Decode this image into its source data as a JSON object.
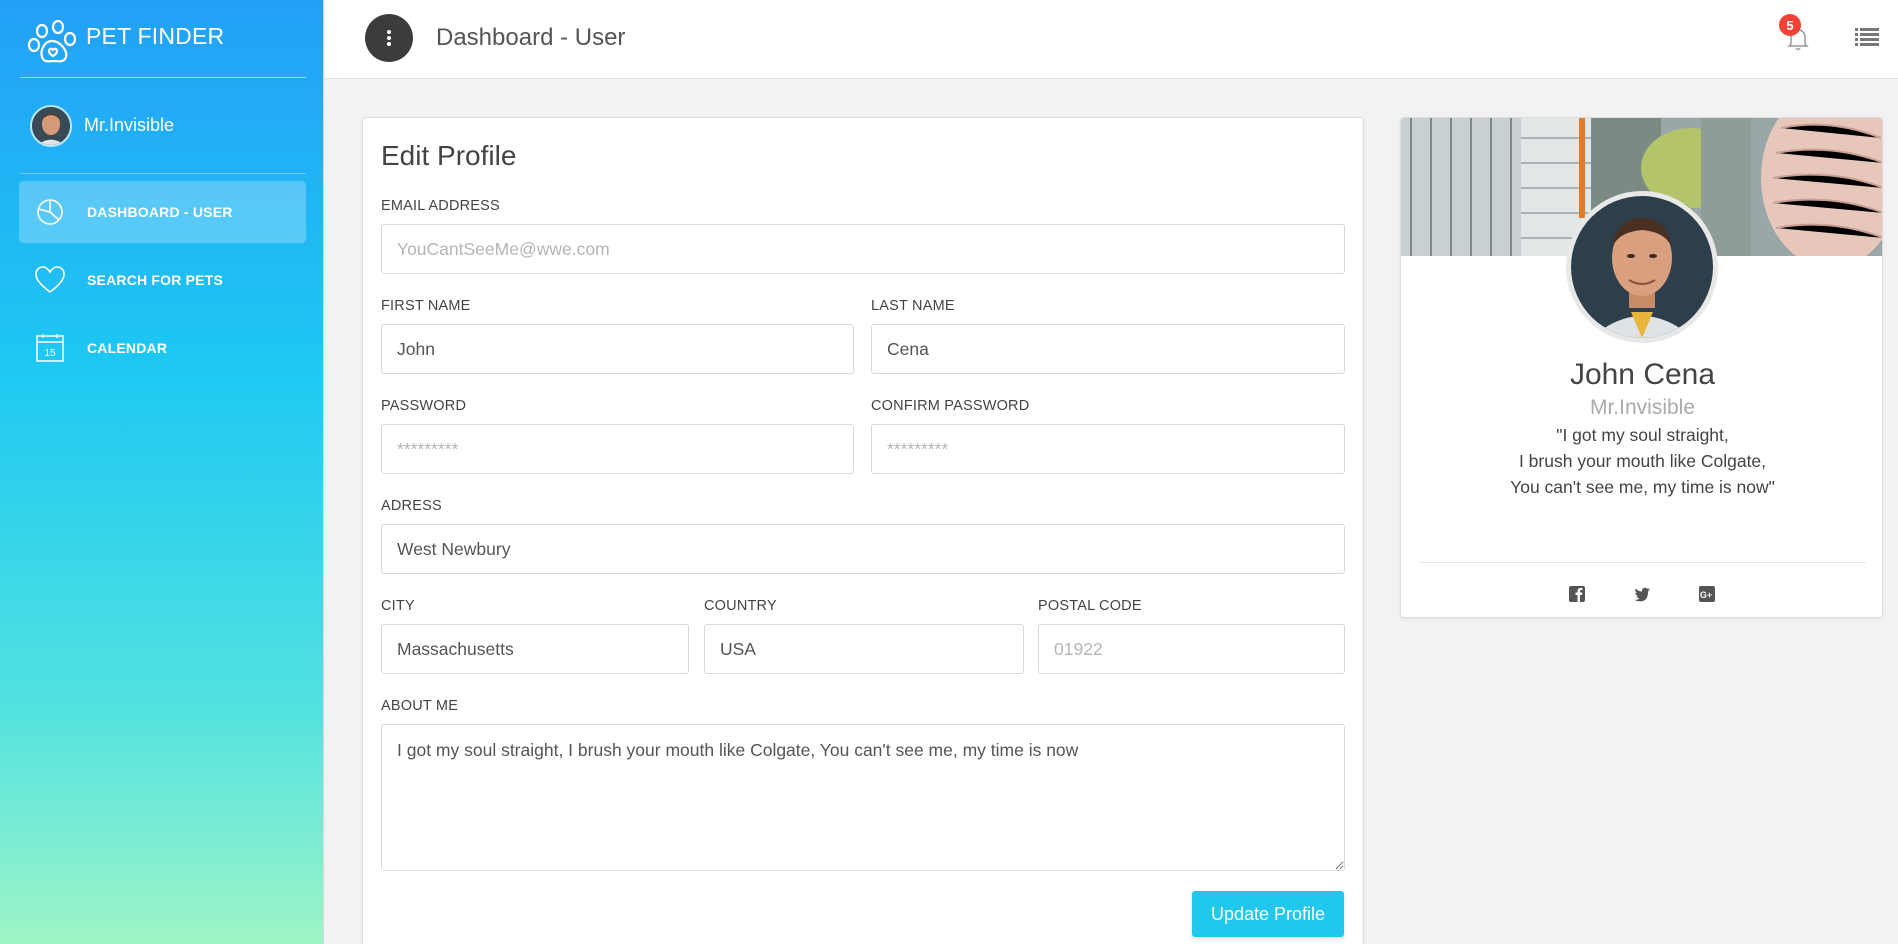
{
  "brand": {
    "name": "PET FINDER"
  },
  "sidebar": {
    "user_name": "Mr.Invisible",
    "items": [
      {
        "label": "DASHBOARD - USER",
        "icon": "pie-chart-icon",
        "active": true
      },
      {
        "label": "SEARCH FOR PETS",
        "icon": "heart-icon",
        "active": false
      },
      {
        "label": "CALENDAR",
        "icon": "calendar-icon",
        "active": false
      }
    ],
    "calendar_day": "15"
  },
  "topbar": {
    "title": "Dashboard - User",
    "notification_count": "5"
  },
  "edit_profile": {
    "title": "Edit Profile",
    "email": {
      "label": "EMAIL ADDRESS",
      "value": "",
      "placeholder": "YouCantSeeMe@wwe.com"
    },
    "first_name": {
      "label": "FIRST NAME",
      "value": "John"
    },
    "last_name": {
      "label": "LAST NAME",
      "value": "Cena"
    },
    "password": {
      "label": "PASSWORD",
      "placeholder": "*********"
    },
    "confirm_password": {
      "label": "CONFIRM PASSWORD",
      "placeholder": "*********"
    },
    "address": {
      "label": "ADRESS",
      "value": "West Newbury"
    },
    "city": {
      "label": "CITY",
      "value": "Massachusetts"
    },
    "country": {
      "label": "COUNTRY",
      "value": "USA"
    },
    "postal_code": {
      "label": "POSTAL CODE",
      "value": "",
      "placeholder": "01922"
    },
    "about_me": {
      "label": "ABOUT ME",
      "value": "I got my soul straight, I brush your mouth like Colgate, You can't see me, my time is now"
    },
    "update_button": "Update Profile"
  },
  "profile_card": {
    "name": "John Cena",
    "username": "Mr.Invisible",
    "quote_line1": "\"I got my soul straight,",
    "quote_line2": "I brush your mouth like Colgate,",
    "quote_line3": "You can't see me, my time is now\"",
    "social": [
      "facebook-icon",
      "twitter-icon",
      "google-plus-icon"
    ]
  },
  "colors": {
    "accent": "#1fc8ec",
    "badge": "#f44336",
    "sidebar_top": "#23a0f7",
    "sidebar_bottom": "#9ef5c6"
  }
}
